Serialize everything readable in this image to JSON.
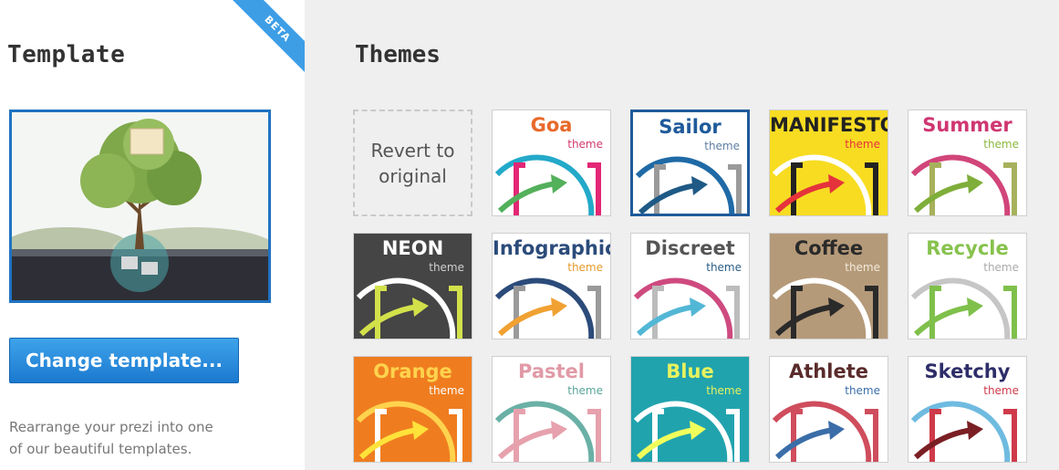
{
  "template_panel": {
    "title": "Template",
    "badge": "BETA",
    "change_button": "Change template...",
    "description_line1": "Rearrange your prezi into one",
    "description_line2": "of our beautiful templates."
  },
  "themes_panel": {
    "title": "Themes",
    "revert_label_line1": "Revert to",
    "revert_label_line2": "original",
    "themes": [
      {
        "name": "Goa",
        "sub": "theme",
        "bg": "#ffffff",
        "name_color": "#e8692b",
        "sub_color": "#d13a6b",
        "arc_color": "#23a9c9",
        "bracket_color": "#e32775",
        "arrow_color": "#53b05b",
        "selected": false
      },
      {
        "name": "Sailor",
        "sub": "theme",
        "bg": "#ffffff",
        "name_color": "#1f5a9a",
        "sub_color": "#5e7fa2",
        "arc_color": "#1f6aa6",
        "bracket_color": "#9a9a9a",
        "arrow_color": "#1f5a86",
        "selected": true
      },
      {
        "name": "MANIFESTO",
        "sub": "theme",
        "bg": "#f7dc22",
        "name_color": "#222222",
        "sub_color": "#e5333b",
        "arc_color": "#ffffff",
        "bracket_color": "#222222",
        "arrow_color": "#e5333b",
        "selected": false
      },
      {
        "name": "Summer",
        "sub": "theme",
        "bg": "#ffffff",
        "name_color": "#cf3671",
        "sub_color": "#8bb83e",
        "arc_color": "#d1457a",
        "bracket_color": "#a7b15c",
        "arrow_color": "#7fae3a",
        "selected": false
      },
      {
        "name": "NEON",
        "sub": "theme",
        "bg": "#454545",
        "name_color": "#ffffff",
        "sub_color": "#cfcfcf",
        "arc_color": "#ffffff",
        "bracket_color": "#d2e14a",
        "arrow_color": "#d2e14a",
        "selected": false
      },
      {
        "name": "Infographic",
        "sub": "theme",
        "bg": "#ffffff",
        "name_color": "#2b4b7a",
        "sub_color": "#e59b2a",
        "arc_color": "#2b4b7a",
        "bracket_color": "#9a9a9a",
        "arrow_color": "#f0a132",
        "selected": false
      },
      {
        "name": "Discreet",
        "sub": "theme",
        "bg": "#ffffff",
        "name_color": "#555555",
        "sub_color": "#2a5d86",
        "arc_color": "#ce4a7f",
        "bracket_color": "#bcbcbc",
        "arrow_color": "#52b7d5",
        "selected": false
      },
      {
        "name": "Coffee",
        "sub": "theme",
        "bg": "#b59a79",
        "name_color": "#2a2a2a",
        "sub_color": "#f2eadc",
        "arc_color": "#ffffff",
        "bracket_color": "#2a2a2a",
        "arrow_color": "#2a2a2a",
        "selected": false
      },
      {
        "name": "Recycle",
        "sub": "theme",
        "bg": "#ffffff",
        "name_color": "#87c24d",
        "sub_color": "#aaaaaa",
        "arc_color": "#c6c6c6",
        "bracket_color": "#7fc04b",
        "arrow_color": "#7fc04b",
        "selected": false
      },
      {
        "name": "Orange",
        "sub": "theme",
        "bg": "#ef7d20",
        "name_color": "#ffd34d",
        "sub_color": "#ffffff",
        "arc_color": "#ffd34d",
        "bracket_color": "#ffffff",
        "arrow_color": "#ffe23a",
        "selected": false
      },
      {
        "name": "Pastel",
        "sub": "theme",
        "bg": "#ffffff",
        "name_color": "#e09aa6",
        "sub_color": "#5aa59a",
        "arc_color": "#6ab0a6",
        "bracket_color": "#e6a1ad",
        "arrow_color": "#e6a1ad",
        "selected": false
      },
      {
        "name": "Blue",
        "sub": "theme",
        "bg": "#21a3ae",
        "name_color": "#e7f25e",
        "sub_color": "#e7f25e",
        "arc_color": "#ffffff",
        "bracket_color": "#ffffff",
        "arrow_color": "#f1ff5b",
        "selected": false
      },
      {
        "name": "Athlete",
        "sub": "theme",
        "bg": "#ffffff",
        "name_color": "#5a2b2b",
        "sub_color": "#3b6ea8",
        "arc_color": "#cf4d5d",
        "bracket_color": "#cf4d5d",
        "arrow_color": "#3b6ea8",
        "selected": false
      },
      {
        "name": "Sketchy",
        "sub": "theme",
        "bg": "#ffffff",
        "name_color": "#2e2e6a",
        "sub_color": "#cf3a4a",
        "arc_color": "#6fbbe0",
        "bracket_color": "#cf3a4a",
        "arrow_color": "#7a1f24",
        "selected": false
      }
    ]
  }
}
